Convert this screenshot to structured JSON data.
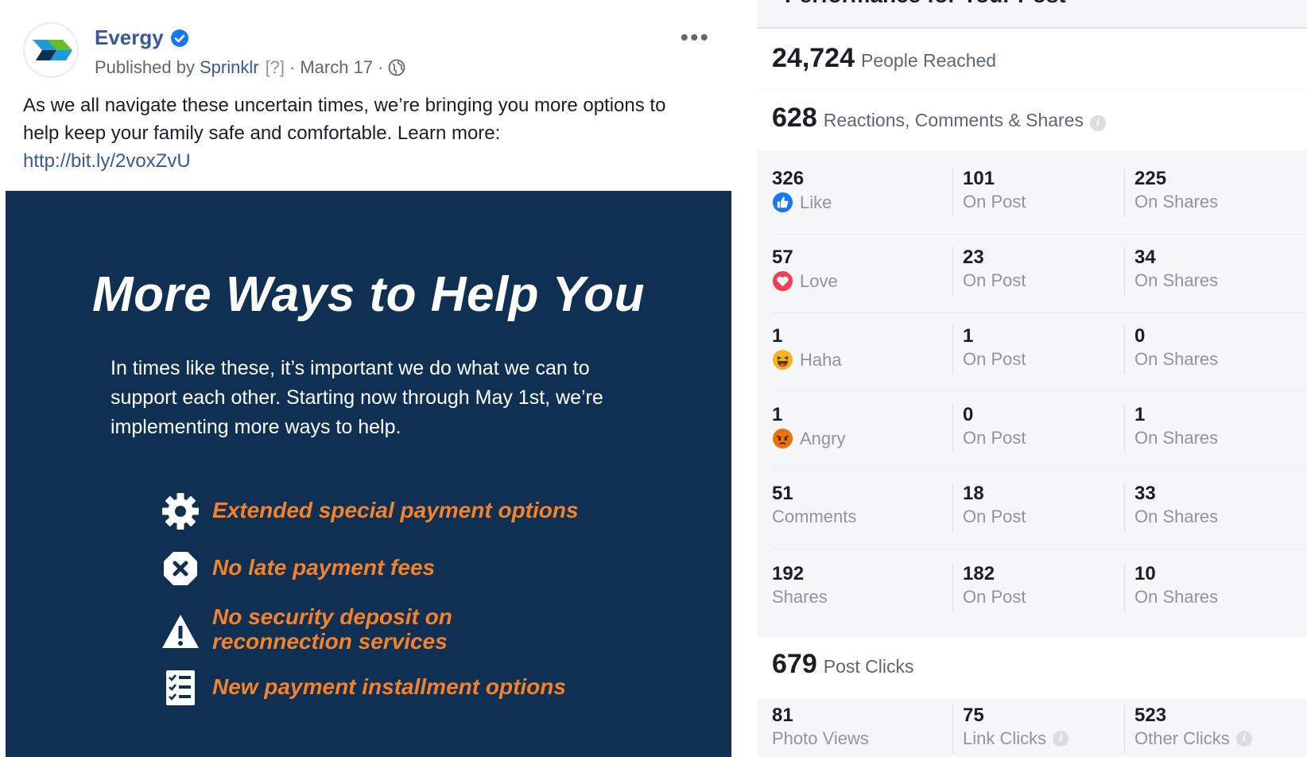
{
  "post": {
    "page_name": "Evergy",
    "published_by_prefix": "Published by",
    "publisher": "Sprinklr",
    "help_marker": "[?]",
    "separator": "·",
    "date": "March 17",
    "more_label": "•••",
    "text": "As we all navigate these uncertain times, we’re bringing you more options to help keep your family safe and comfortable. Learn more:",
    "link": "http://bit.ly/2voxZvU"
  },
  "banner": {
    "title": "More Ways to Help You",
    "body": "In times like these, it’s important we do what we can to support each other. Starting now through May 1st, we’re implementing more ways to help.",
    "benefits": [
      {
        "icon": "gear-icon",
        "line1": "Extended special payment options",
        "line2": ""
      },
      {
        "icon": "x-circle-icon",
        "line1": "No late payment fees",
        "line2": ""
      },
      {
        "icon": "warning-icon",
        "line1": "No security deposit on",
        "line2": "reconnection services"
      },
      {
        "icon": "checklist-icon",
        "line1": "New payment installment options",
        "line2": ""
      }
    ],
    "background_color": "#0f3052",
    "accent_color": "#f5822a"
  },
  "insights": {
    "title_partial": "Performance for Your Post",
    "reach": {
      "value": "24,724",
      "label": "People Reached"
    },
    "engagement": {
      "value": "628",
      "label": "Reactions, Comments & Shares"
    },
    "rows": [
      {
        "value": "326",
        "label": "Like",
        "icon": "like-icon",
        "on_post": "101",
        "on_post_label": "On Post",
        "on_shares": "225",
        "on_shares_label": "On Shares"
      },
      {
        "value": "57",
        "label": "Love",
        "icon": "love-icon",
        "on_post": "23",
        "on_post_label": "On Post",
        "on_shares": "34",
        "on_shares_label": "On Shares"
      },
      {
        "value": "1",
        "label": "Haha",
        "icon": "haha-icon",
        "on_post": "1",
        "on_post_label": "On Post",
        "on_shares": "0",
        "on_shares_label": "On Shares"
      },
      {
        "value": "1",
        "label": "Angry",
        "icon": "angry-icon",
        "on_post": "0",
        "on_post_label": "On Post",
        "on_shares": "1",
        "on_shares_label": "On Shares"
      },
      {
        "value": "51",
        "label": "Comments",
        "icon": "",
        "on_post": "18",
        "on_post_label": "On Post",
        "on_shares": "33",
        "on_shares_label": "On Shares"
      },
      {
        "value": "192",
        "label": "Shares",
        "icon": "",
        "on_post": "182",
        "on_post_label": "On Post",
        "on_shares": "10",
        "on_shares_label": "On Shares"
      }
    ],
    "clicks": {
      "value": "679",
      "label": "Post Clicks",
      "photo_views": "81",
      "photo_views_label": "Photo Views",
      "link_clicks": "75",
      "link_clicks_label": "Link Clicks",
      "other_clicks": "523",
      "other_clicks_label": "Other Clicks"
    },
    "info_glyph": "i"
  }
}
